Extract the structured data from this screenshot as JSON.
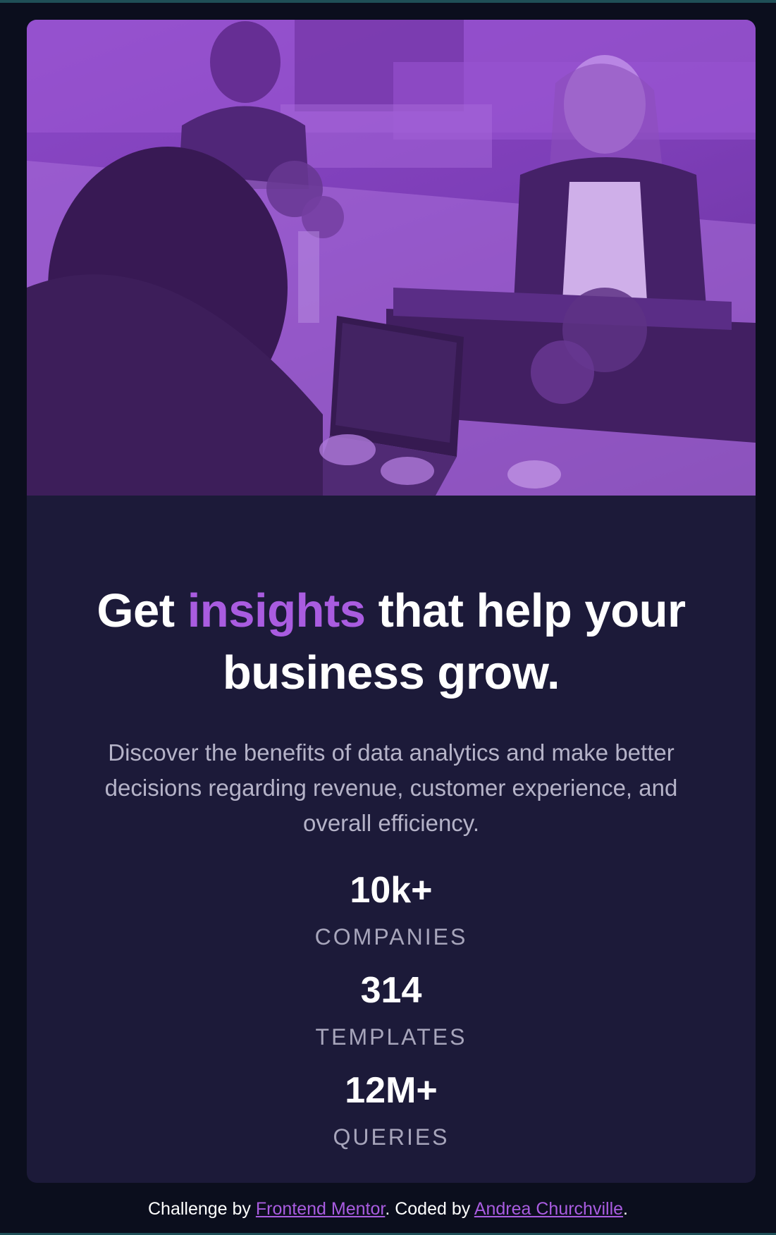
{
  "card": {
    "image": {
      "alt_semantic": "office-photo",
      "tint_color": "#8c49c7"
    },
    "headline": {
      "before": "Get ",
      "accent": "insights",
      "after": " that help your business grow."
    },
    "description": "Discover the benefits of data analytics and make better decisions regarding revenue, customer experience, and overall efficiency.",
    "stats": [
      {
        "value": "10k+",
        "label": "COMPANIES"
      },
      {
        "value": "314",
        "label": "TEMPLATES"
      },
      {
        "value": "12M+",
        "label": "QUERIES"
      }
    ]
  },
  "footer": {
    "prefix": "Challenge by ",
    "link1": "Frontend Mentor",
    "middle": ". Coded by ",
    "link2": "Andrea Churchville",
    "suffix": "."
  },
  "colors": {
    "page_bg": "#0b0e1d",
    "card_bg": "#1c1a39",
    "accent": "#a95ce0",
    "muted_text": "#b5b3c8"
  }
}
